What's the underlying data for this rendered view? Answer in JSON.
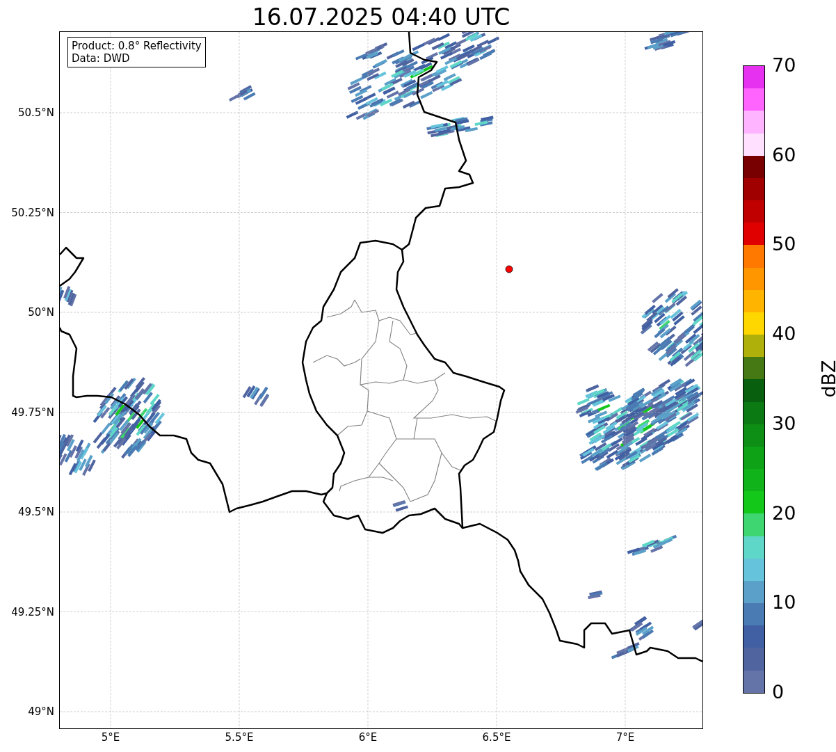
{
  "title": "16.07.2025 04:40 UTC",
  "info_box": {
    "lines": [
      "Product: 0.8° Reflectivity",
      "Data: DWD"
    ]
  },
  "lat_ticks": [
    "50.5°N",
    "50.25°N",
    "50°N",
    "49.75°N",
    "49.5°N",
    "49.25°N",
    "49°N"
  ],
  "lon_ticks": [
    "5°E",
    "5.5°E",
    "6°E",
    "6.5°E",
    "7°E"
  ],
  "colorbar": {
    "label": "dBZ",
    "ticks": [
      "70",
      "60",
      "50",
      "40",
      "30",
      "20",
      "10",
      "0"
    ],
    "segments": [
      {
        "color": "#6574a8"
      },
      {
        "color": "#5065a0"
      },
      {
        "color": "#4060a3"
      },
      {
        "color": "#4a7bb3"
      },
      {
        "color": "#5aa0c8"
      },
      {
        "color": "#66c3dc"
      },
      {
        "color": "#5fd7c8"
      },
      {
        "color": "#3dd670"
      },
      {
        "color": "#14c81a"
      },
      {
        "color": "#10b41a"
      },
      {
        "color": "#0ea216"
      },
      {
        "color": "#0d8e14"
      },
      {
        "color": "#0b7a12"
      },
      {
        "color": "#08600e"
      },
      {
        "color": "#467814"
      },
      {
        "color": "#b0b00a"
      },
      {
        "color": "#ffd700"
      },
      {
        "color": "#ffb400"
      },
      {
        "color": "#ff9600"
      },
      {
        "color": "#ff7800"
      },
      {
        "color": "#e00000"
      },
      {
        "color": "#c00000"
      },
      {
        "color": "#a00000"
      },
      {
        "color": "#780000"
      },
      {
        "color": "#ffe0ff"
      },
      {
        "color": "#ffb4ff"
      },
      {
        "color": "#ff64ff"
      },
      {
        "color": "#e632f0"
      }
    ]
  }
}
